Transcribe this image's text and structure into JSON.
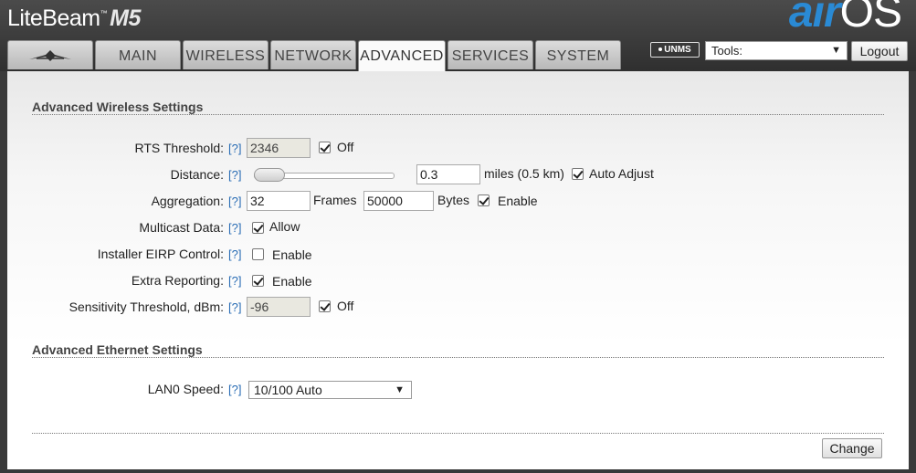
{
  "brand": {
    "name": "LiteBeam",
    "tm": "™",
    "model": "M5"
  },
  "airos_logo": {
    "air": "air",
    "os": "OS"
  },
  "tabs": [
    {
      "label": "",
      "icon": "ubiquiti-logo-icon"
    },
    {
      "label": "MAIN"
    },
    {
      "label": "WIRELESS"
    },
    {
      "label": "NETWORK"
    },
    {
      "label": "ADVANCED",
      "active": true
    },
    {
      "label": "SERVICES"
    },
    {
      "label": "SYSTEM"
    }
  ],
  "toolbar": {
    "unms_label": "UNMS",
    "tools_label": "Tools:",
    "logout_label": "Logout"
  },
  "help_label": "[?]",
  "wireless": {
    "title": "Advanced Wireless Settings",
    "rts": {
      "label": "RTS Threshold:",
      "value": "2346",
      "checkbox_checked": true,
      "checkbox_label": "Off"
    },
    "distance": {
      "label": "Distance:",
      "value": "0.3",
      "unit": "miles (0.5 km)",
      "slider_fraction": 0.02,
      "auto_checked": true,
      "auto_label": "Auto Adjust"
    },
    "aggregation": {
      "label": "Aggregation:",
      "frames_value": "32",
      "frames_unit": "Frames",
      "bytes_value": "50000",
      "bytes_unit": "Bytes",
      "enable_checked": true,
      "enable_label": "Enable"
    },
    "multicast": {
      "label": "Multicast Data:",
      "checked": true,
      "checkbox_label": "Allow"
    },
    "eirp": {
      "label": "Installer EIRP Control:",
      "checked": false,
      "checkbox_label": "Enable"
    },
    "extra": {
      "label": "Extra Reporting:",
      "checked": true,
      "checkbox_label": "Enable"
    },
    "sensitivity": {
      "label": "Sensitivity Threshold, dBm:",
      "value": "-96",
      "checkbox_checked": true,
      "checkbox_label": "Off"
    }
  },
  "ethernet": {
    "title": "Advanced Ethernet Settings",
    "lan0": {
      "label": "LAN0 Speed:",
      "value": "10/100 Auto"
    }
  },
  "actions": {
    "change_label": "Change"
  },
  "colors": {
    "header_bg": "#3a3a3a",
    "link": "#2a6db5",
    "airos_blue": "#2a8ad4"
  }
}
